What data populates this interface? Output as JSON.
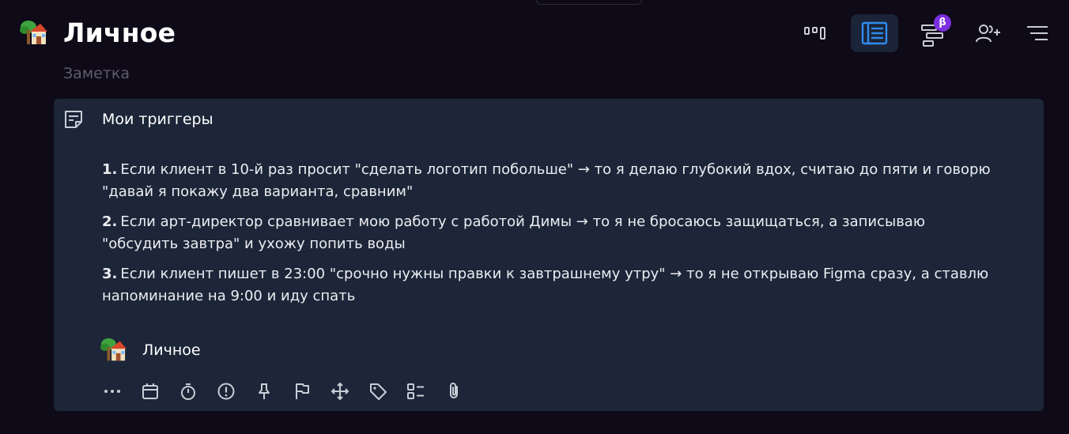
{
  "header": {
    "title": "Личное",
    "subtitle": "Заметка",
    "project_icon": "house-with-tree-emoji",
    "beta_label": "β"
  },
  "views": [
    {
      "name": "board-view-icon",
      "active": false
    },
    {
      "name": "list-view-icon",
      "active": true
    },
    {
      "name": "timeline-view-icon",
      "active": false,
      "badge": "β"
    },
    {
      "name": "add-member-icon",
      "active": false
    },
    {
      "name": "sort-icon",
      "active": false
    }
  ],
  "note": {
    "icon": "note-icon",
    "title": "Мои триггеры",
    "items": [
      {
        "num": "1.",
        "text": "Если клиент в 10-й раз просит \"сделать логотип побольше\" → то я делаю глубокий вдох, считаю до пяти и говорю \"давай я покажу два варианта, сравним\""
      },
      {
        "num": "2.",
        "text": "Если арт-директор сравнивает мою работу с работой Димы → то я не бросаюсь защищаться, а записываю \"обсудить завтра\" и ухожу попить воды"
      },
      {
        "num": "3.",
        "text": "Если клиент пишет в 23:00 \"срочно нужны правки к завтрашнему утру\" → то я не открываю Figma сразу, а ставлю напоминание на 9:00 и иду спать"
      }
    ],
    "project_label": "Личное"
  },
  "toolbar": {
    "icons": [
      "more-icon",
      "calendar-icon",
      "timer-icon",
      "priority-icon",
      "pin-icon",
      "flag-icon",
      "move-icon",
      "tag-icon",
      "checklist-icon",
      "attachment-icon"
    ]
  },
  "colors": {
    "background": "#0e0a17",
    "card": "#1c2638",
    "accent": "#2f8cf0",
    "beta": "#7b2fe0",
    "icon": "#c9cdd6"
  }
}
